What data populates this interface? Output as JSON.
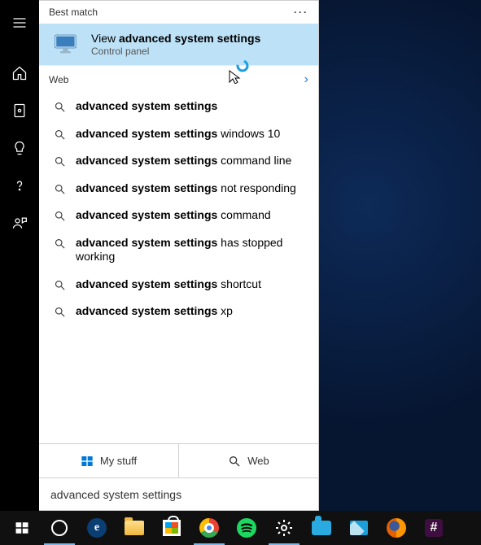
{
  "sections": {
    "best_match": "Best match",
    "web": "Web"
  },
  "best_match": {
    "prefix": "View ",
    "bold": "advanced system settings",
    "subtitle": "Control panel"
  },
  "web_results": [
    {
      "bold": "advanced system settings",
      "rest": ""
    },
    {
      "bold": "advanced system settings",
      "rest": " windows 10"
    },
    {
      "bold": "advanced system settings",
      "rest": " command line"
    },
    {
      "bold": "advanced system settings",
      "rest": " not responding"
    },
    {
      "bold": "advanced system settings",
      "rest": " command"
    },
    {
      "bold": "advanced system settings",
      "rest": " has stopped working"
    },
    {
      "bold": "advanced system settings",
      "rest": " shortcut"
    },
    {
      "bold": "advanced system settings",
      "rest": " xp"
    }
  ],
  "scope": {
    "my_stuff": "My stuff",
    "web": "Web"
  },
  "search_query": "advanced system settings",
  "more_symbol": "···",
  "slack_glyph": "#"
}
